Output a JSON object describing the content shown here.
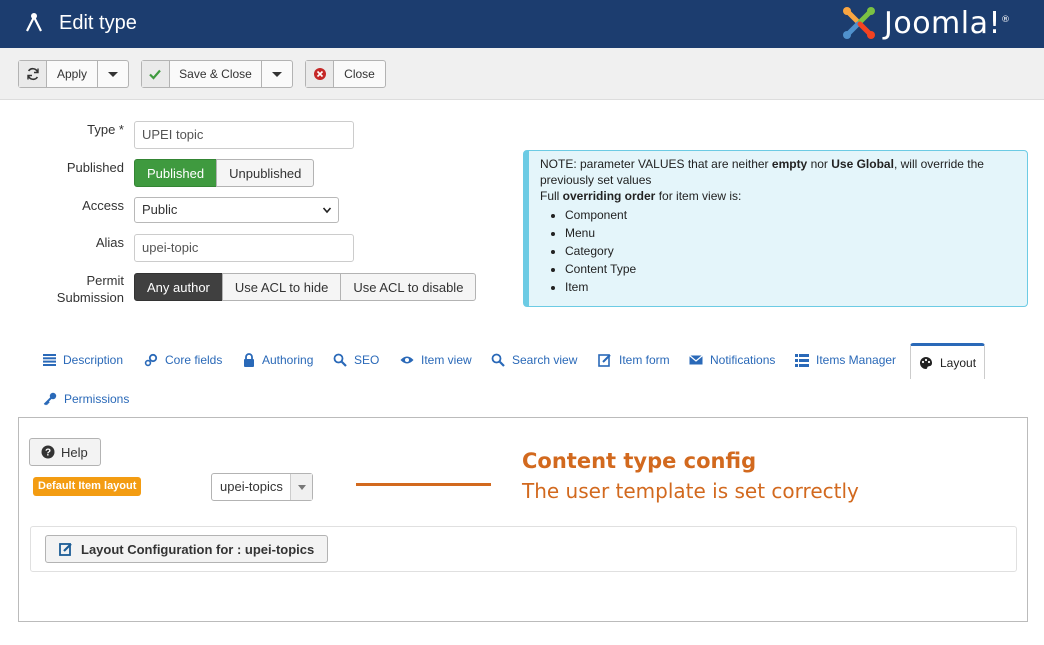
{
  "header": {
    "title": "Edit type",
    "logo_text": "Joomla!",
    "logo_reg": "®",
    "bg_color": "#1c3d6f"
  },
  "toolbar": {
    "apply_label": "Apply",
    "save_close_label": "Save & Close",
    "close_label": "Close",
    "icons": [
      "refresh-icon",
      "check-icon",
      "cancel-icon",
      "chevron-down-icon"
    ]
  },
  "form": {
    "type": {
      "label": "Type *",
      "value": "UPEI topic"
    },
    "published": {
      "label": "Published",
      "options": [
        "Published",
        "Unpublished"
      ],
      "selected": "Published"
    },
    "access": {
      "label": "Access",
      "value": "Public"
    },
    "alias": {
      "label": "Alias",
      "value": "upei-topic"
    },
    "permit": {
      "label_line1": "Permit",
      "label_line2": "Submission",
      "options": [
        "Any author",
        "Use ACL to hide",
        "Use ACL to disable"
      ],
      "selected": "Any author"
    }
  },
  "note": {
    "l1_a": "NOTE: parameter VALUES that are neither ",
    "l1_b": "empty",
    "l1_c": " nor ",
    "l1_d": "Use Global",
    "l1_e": ", will override the previously set values",
    "l2_a": "Full ",
    "l2_b": "overriding order",
    "l2_c": " for item view is:",
    "items": [
      "Component",
      "Menu",
      "Category",
      "Content Type",
      "Item"
    ]
  },
  "tabs": {
    "description": "Description",
    "core_fields": "Core fields",
    "authoring": "Authoring",
    "seo": "SEO",
    "item_view": "Item view",
    "search_view": "Search view",
    "item_form": "Item form",
    "notifications": "Notifications",
    "items_manager": "Items Manager",
    "layout": "Layout",
    "permissions": "Permissions",
    "active": "Layout"
  },
  "layout_panel": {
    "help_label": "Help",
    "badge_label": "Default Item layout",
    "layout_value": "upei-topics",
    "config_button": "Layout Configuration for : upei-topics"
  },
  "annotation": {
    "title": "Content type config",
    "subtitle": "The user template is set correctly",
    "color": "#d2691e"
  },
  "colors": {
    "accent": "#2a69b8",
    "published_green": "#3f9a3f",
    "note_bg": "#e4f5fa",
    "badge_orange": "#f39c12"
  }
}
